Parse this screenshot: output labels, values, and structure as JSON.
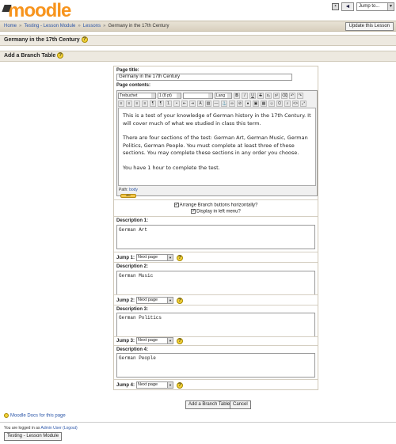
{
  "site": {
    "logo": "moodle"
  },
  "top_right": {
    "jump_to": "Jump to..."
  },
  "breadcrumb": {
    "items": [
      "Home",
      "Testing - Lesson Module",
      "Lessons"
    ],
    "current": "Germany in the 17th Century"
  },
  "update_button": "Update this Lesson",
  "lesson_heading": "Germany in the 17th Century",
  "section_heading": "Add a Branch Table",
  "form": {
    "page_title_label": "Page title:",
    "page_title_value": "Germany in the 17th Century",
    "page_contents_label": "Page contents:",
    "editor": {
      "font": "Trebuchet",
      "size": "1 (8 pt)",
      "lang": "Lang",
      "paragraphs": [
        "This is a test of your knowledge of German history in the 17th Century. It will cover much of what we studied in class this term.",
        "There are four sections of the test: German Art, German Music, German Politics, German People. You must complete at least three of these sections. You may complete these sections in any order you choose.",
        "You have 1 hour to complete the test."
      ],
      "path_label": "Path:",
      "path_value": "body"
    },
    "arrange_label": "Arrange Branch buttons horizontally?",
    "display_left_label": "Display in left menu?",
    "descriptions": [
      {
        "label": "Description 1:",
        "value": "German Art",
        "jump_label": "Jump 1:",
        "jump_value": "Next page"
      },
      {
        "label": "Description 2:",
        "value": "German Music",
        "jump_label": "Jump 2:",
        "jump_value": "Next page"
      },
      {
        "label": "Description 3:",
        "value": "German Politics",
        "jump_label": "Jump 3:",
        "jump_value": "Next page"
      },
      {
        "label": "Description 4:",
        "value": "German People",
        "jump_label": "Jump 4:",
        "jump_value": "Next page"
      }
    ]
  },
  "buttons": {
    "add": "Add a Branch Table",
    "cancel": "Cancel"
  },
  "footer": {
    "docs_link": "Moodle Docs for this page",
    "logged_prefix": "You are logged in as",
    "user": "Admin User",
    "logout": "(Logout)",
    "course_button": "Testing - Lesson Module"
  }
}
